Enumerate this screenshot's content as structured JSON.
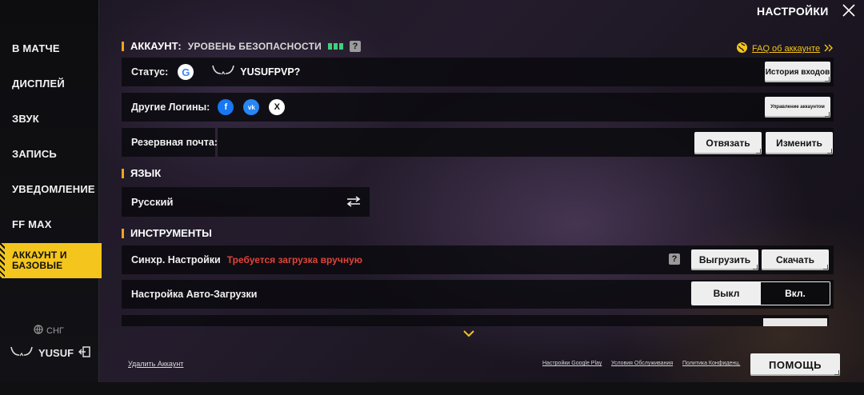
{
  "header": {
    "title": "НАСТРОЙКИ"
  },
  "sidebar": {
    "items": [
      {
        "label": "В МАТЧЕ"
      },
      {
        "label": "ДИСПЛЕЙ"
      },
      {
        "label": "ЗВУК"
      },
      {
        "label": "ЗАПИСЬ"
      },
      {
        "label": "УВЕДОМЛЕНИЕ"
      },
      {
        "label": "FF MAX"
      },
      {
        "label": "АККАУНТ И БАЗОВЫЕ"
      }
    ],
    "active_index": 6,
    "region": "СНГ",
    "username": "YUSUF"
  },
  "account": {
    "title": "АККАУНТ:",
    "security_label": "УРОВЕНЬ БЕЗОПАСНОСТИ",
    "security_level": 3,
    "faq_label": "FAQ об аккаунте",
    "status_label": "Статус:",
    "status_name": "YUSUFPVP?",
    "login_history_button": "История входов",
    "other_logins_label": "Другие Логины:",
    "other_logins": [
      "facebook",
      "vk",
      "x"
    ],
    "manage_account_button": "Управление аккаунтом",
    "backup_email_label": "Резервная почта:",
    "unlink_button": "Отвязать",
    "change_button": "Изменить"
  },
  "language": {
    "title": "ЯЗЫК",
    "current": "Русский"
  },
  "tools": {
    "title": "ИНСТРУМЕНТЫ",
    "sync_label": "Синхр. Настройки",
    "sync_warning": "Требуется загрузка вручную",
    "upload_button": "Выгрузить",
    "download_button": "Скачать",
    "autoload_label": "Настройка Авто-Загрузки",
    "toggle_off": "Выкл",
    "toggle_on": "Вкл.",
    "toggle_selected": "Вкл."
  },
  "footer": {
    "delete_account": "Удалить Аккаунт",
    "google_play_settings": "Настройки Google Play",
    "terms": "Условия Обслуживания",
    "privacy": "Политика Конфиденц.",
    "help_button": "ПОМОЩЬ"
  },
  "colors": {
    "accent": "#f4c51c",
    "section_bar": "#f4a21c",
    "security_ok": "#3fd07a",
    "warning": "#e0443a"
  }
}
